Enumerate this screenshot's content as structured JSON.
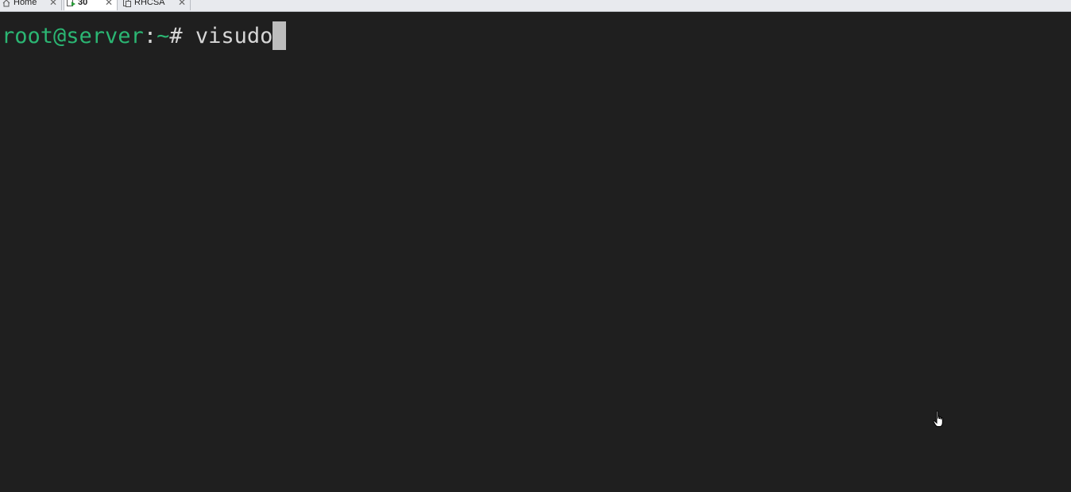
{
  "tabs": [
    {
      "label": "Home",
      "icon": "home-icon",
      "active": false
    },
    {
      "label": "30",
      "icon": "vm-running-icon",
      "active": true
    },
    {
      "label": "RHCSA",
      "icon": "vm-icon",
      "active": false
    }
  ],
  "terminal": {
    "prompt_user_host": "root@server",
    "prompt_separator": ":",
    "prompt_path": "~",
    "prompt_symbol": "# ",
    "command": "visudo"
  },
  "colors": {
    "terminal_bg": "#1f1f1f",
    "prompt_green": "#2bb673",
    "text": "#d6d6d6",
    "cursor": "#bdbdbd"
  }
}
